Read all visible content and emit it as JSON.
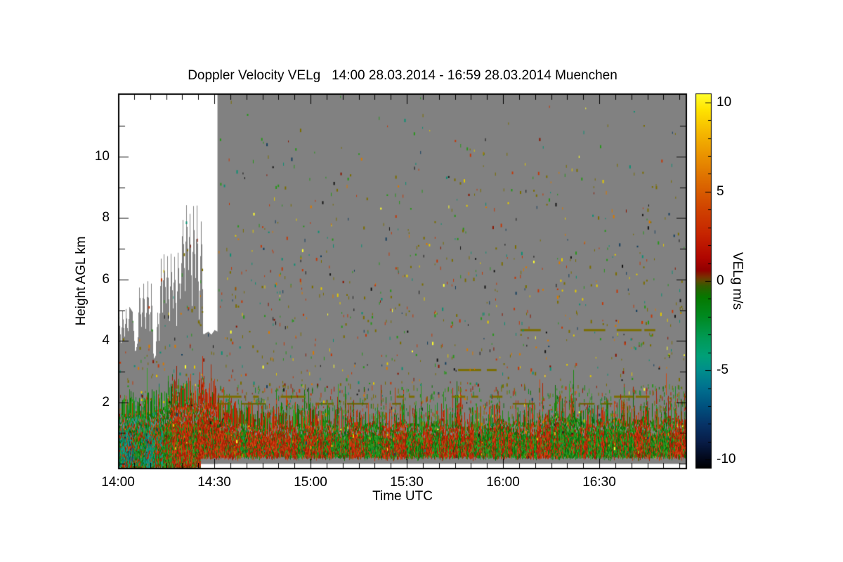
{
  "title": "Doppler Velocity VELg   14:00 28.03.2014 - 16:59 28.03.2014 Muenchen",
  "chart_data": {
    "type": "heatmap",
    "title": "Doppler Velocity VELg   14:00 28.03.2014 - 16:59 28.03.2014 Muenchen",
    "xlabel": "Time UTC",
    "ylabel": "Height AGL km",
    "grid": false,
    "legend_position": "right-colorbar",
    "x_axis": {
      "ticks": [
        "14:00",
        "14:30",
        "15:00",
        "15:30",
        "16:00",
        "16:30"
      ],
      "tick_minutes": [
        0,
        30,
        60,
        90,
        120,
        150
      ],
      "range_minutes": [
        0,
        177.3
      ],
      "minor_tick_minutes": 5
    },
    "y_axis": {
      "ticks": [
        2,
        4,
        6,
        8,
        10
      ],
      "range_km": [
        -0.17,
        12.07
      ],
      "minor_tick_km": 1
    },
    "colorbar": {
      "label": "VELg m/s",
      "ticks": [
        10,
        5,
        0,
        -5,
        -10
      ],
      "range": [
        -10.5,
        10.5
      ],
      "minor_tick_step": 1,
      "stops": [
        [
          10.5,
          "#ffff2e"
        ],
        [
          9.6,
          "#ffe400"
        ],
        [
          8.4,
          "#f6bb00"
        ],
        [
          7.0,
          "#ea9200"
        ],
        [
          5.5,
          "#dc6900"
        ],
        [
          4.0,
          "#d04200"
        ],
        [
          2.6,
          "#c62400"
        ],
        [
          1.3,
          "#b00600"
        ],
        [
          0.6,
          "#920000"
        ],
        [
          0.25,
          "#7a2d00"
        ],
        [
          0.0,
          "#5c4a00"
        ],
        [
          -0.3,
          "#2f5e00"
        ],
        [
          -0.9,
          "#067900"
        ],
        [
          -2.0,
          "#008a21"
        ],
        [
          -3.2,
          "#009a56"
        ],
        [
          -4.2,
          "#00a078"
        ],
        [
          -5.0,
          "#008e8c"
        ],
        [
          -6.0,
          "#00708f"
        ],
        [
          -7.0,
          "#00527f"
        ],
        [
          -8.0,
          "#073468"
        ],
        [
          -9.0,
          "#081d48"
        ],
        [
          -10.0,
          "#020718"
        ],
        [
          -10.5,
          "#000000"
        ]
      ]
    },
    "background_color": "#ffffff",
    "no_data_color": "#818181",
    "full_column_gray_from_minute": 31,
    "surface_gap": {
      "from_minute": 25.7,
      "below_km": 0.18,
      "color": "#ffffff"
    },
    "echo_top_profile_min_km": [
      [
        0,
        5.05
      ],
      [
        0.9,
        3.9
      ],
      [
        1.3,
        5.0
      ],
      [
        2,
        4.1
      ],
      [
        2.4,
        5.05
      ],
      [
        3,
        4.2
      ],
      [
        3.5,
        5.1
      ],
      [
        4.4,
        4.95
      ],
      [
        5.3,
        3.6
      ],
      [
        6.1,
        4.0
      ],
      [
        6.6,
        5.85
      ],
      [
        7.2,
        4.4
      ],
      [
        7.9,
        5.9
      ],
      [
        8.5,
        4.3
      ],
      [
        9.2,
        5.95
      ],
      [
        9.9,
        4.2
      ],
      [
        10.3,
        5.9
      ],
      [
        11,
        3.4
      ],
      [
        11.6,
        3.5
      ],
      [
        12.3,
        5.0
      ],
      [
        12.7,
        4.0
      ],
      [
        13.4,
        6.85
      ],
      [
        13.8,
        4.9
      ],
      [
        14.2,
        6.9
      ],
      [
        14.9,
        5.2
      ],
      [
        15.3,
        6.85
      ],
      [
        16,
        4.6
      ],
      [
        16.4,
        6.9
      ],
      [
        17.1,
        5.0
      ],
      [
        17.5,
        6.8
      ],
      [
        18.2,
        4.4
      ],
      [
        18.6,
        6.9
      ],
      [
        19.3,
        5.3
      ],
      [
        19.7,
        6.5
      ],
      [
        20.1,
        8.1
      ],
      [
        20.8,
        5.6
      ],
      [
        21.2,
        8.55
      ],
      [
        21.9,
        6.3
      ],
      [
        22.3,
        8.3
      ],
      [
        23,
        5.1
      ],
      [
        23.4,
        8.5
      ],
      [
        24.1,
        6.0
      ],
      [
        24.5,
        8.55
      ],
      [
        25.2,
        4.6
      ],
      [
        25.9,
        8.2
      ],
      [
        26.5,
        4.2
      ],
      [
        27.2,
        4.25
      ],
      [
        28.1,
        4.3
      ],
      [
        29,
        4.2
      ],
      [
        30,
        4.35
      ],
      [
        31,
        4.3
      ]
    ],
    "boundary_layer": {
      "red_fraction_points": [
        [
          0,
          0.07
        ],
        [
          10,
          0.08
        ],
        [
          14,
          0.12
        ],
        [
          16,
          0.3
        ],
        [
          17.5,
          0.5
        ],
        [
          19,
          0.62
        ],
        [
          21,
          0.5
        ],
        [
          22.5,
          0.75
        ],
        [
          24,
          0.65
        ],
        [
          25.5,
          0.85
        ],
        [
          27,
          0.95
        ],
        [
          28.5,
          0.9
        ],
        [
          30,
          0.85
        ],
        [
          31.5,
          0.9
        ],
        [
          33,
          0.85
        ],
        [
          35,
          0.6
        ],
        [
          37,
          0.45
        ],
        [
          40,
          0.38
        ],
        [
          44,
          0.5
        ],
        [
          47,
          0.6
        ],
        [
          49,
          0.5
        ],
        [
          53,
          0.45
        ],
        [
          56,
          0.35
        ],
        [
          59,
          0.5
        ],
        [
          62,
          0.55
        ],
        [
          66,
          0.4
        ],
        [
          70,
          0.45
        ],
        [
          74,
          0.55
        ],
        [
          79,
          0.4
        ],
        [
          83,
          0.5
        ],
        [
          88,
          0.6
        ],
        [
          92,
          0.45
        ],
        [
          96,
          0.35
        ],
        [
          101,
          0.45
        ],
        [
          105,
          0.55
        ],
        [
          110,
          0.5
        ],
        [
          114,
          0.4
        ],
        [
          118,
          0.5
        ],
        [
          123,
          0.45
        ],
        [
          127,
          0.55
        ],
        [
          131,
          0.5
        ],
        [
          136,
          0.33
        ],
        [
          140,
          0.28
        ],
        [
          143,
          0.25
        ],
        [
          147,
          0.35
        ],
        [
          151,
          0.5
        ],
        [
          155,
          0.55
        ],
        [
          160,
          0.45
        ],
        [
          164,
          0.5
        ],
        [
          169,
          0.55
        ],
        [
          173,
          0.5
        ],
        [
          177,
          0.55
        ]
      ],
      "top_km_points": [
        [
          0,
          1.6
        ],
        [
          3,
          1.75
        ],
        [
          6,
          1.6
        ],
        [
          9,
          1.8
        ],
        [
          12,
          1.7
        ],
        [
          14,
          1.85
        ],
        [
          16,
          1.95
        ],
        [
          18,
          2.05
        ],
        [
          20,
          1.95
        ],
        [
          22,
          2.15
        ],
        [
          24,
          2.05
        ],
        [
          26,
          2.3
        ],
        [
          28,
          2.0
        ],
        [
          30,
          2.1
        ],
        [
          31,
          1.7
        ],
        [
          34,
          1.5
        ],
        [
          38,
          1.35
        ],
        [
          45,
          1.3
        ],
        [
          55,
          1.35
        ],
        [
          65,
          1.3
        ],
        [
          75,
          1.35
        ],
        [
          85,
          1.3
        ],
        [
          95,
          1.35
        ],
        [
          105,
          1.3
        ],
        [
          115,
          1.35
        ],
        [
          125,
          1.3
        ],
        [
          133,
          1.45
        ],
        [
          137,
          1.7
        ],
        [
          141,
          1.55
        ],
        [
          145,
          1.4
        ],
        [
          150,
          1.35
        ],
        [
          155,
          1.45
        ],
        [
          160,
          1.4
        ],
        [
          165,
          1.35
        ],
        [
          170,
          1.4
        ],
        [
          177,
          1.45
        ]
      ]
    },
    "streak_lines": [
      {
        "km": 2.18,
        "from_minute": 31,
        "to_minute": 177.3,
        "color": "#7b6e00",
        "density": 0.55,
        "thickness": 3
      },
      {
        "km": 1.95,
        "from_minute": 31,
        "to_minute": 177.3,
        "color": "#6e6200",
        "density": 0.3,
        "thickness": 2
      },
      {
        "km": 3.05,
        "from_minute": 106,
        "to_minute": 118,
        "color": "#7b6e00",
        "density": 0.5,
        "thickness": 3
      },
      {
        "km": 4.35,
        "from_minute": 114,
        "to_minute": 177.3,
        "color": "#7b6e00",
        "density": 0.45,
        "thickness": 3
      }
    ],
    "palette": {
      "gray": "#818181",
      "green": [
        "#1e8a12",
        "#2a961d",
        "#107407",
        "#37a32b",
        "#168c2e",
        "#0c6b10"
      ],
      "teal": [
        "#0e8f74",
        "#129a80",
        "#0b7f6e",
        "#1d9a89",
        "#0a8a5e"
      ],
      "navy": [
        "#16405f",
        "#1b4d74",
        "#0f3048",
        "#1d5a84"
      ],
      "red": [
        "#c23a0b",
        "#b22806",
        "#cf4a14",
        "#a82003",
        "#c52f0e",
        "#992105"
      ],
      "dark_red": "#8a1703",
      "dark_olive": "#4f4a00",
      "olive": "#7b6e00",
      "speckles": [
        [
          "#7b6e00",
          0.27
        ],
        [
          "#2a961d",
          0.16
        ],
        [
          "#c23a0b",
          0.13
        ],
        [
          "#0e8f74",
          0.1
        ],
        [
          "#e3c900",
          0.08
        ],
        [
          "#d97900",
          0.07
        ],
        [
          "#151515",
          0.07
        ],
        [
          "#16405f",
          0.05
        ],
        [
          "#8a1703",
          0.04
        ],
        [
          "#ffff2e",
          0.03
        ]
      ]
    }
  }
}
